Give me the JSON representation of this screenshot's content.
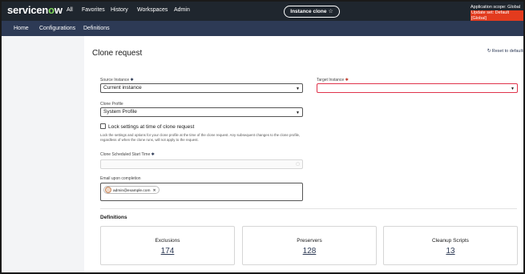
{
  "topbar": {
    "logo_main": "servicen",
    "logo_o": "o",
    "logo_end": "w",
    "nav": [
      "All",
      "Favorites",
      "History",
      "Workspaces",
      "Admin"
    ],
    "instance_pill": "Instance clone",
    "pill_icon": "star-icon",
    "scope_line": "Application scope: Global",
    "update_set_line": "Update set: Default [Global]"
  },
  "subnav": [
    "Home",
    "Configurations",
    "Definitions"
  ],
  "page": {
    "title": "Clone request",
    "reset_label": "Reset to defaults",
    "reset_icon": "refresh-icon"
  },
  "form": {
    "source_label": "Source Instance",
    "source_value": "Current instance",
    "target_label": "Target Instance",
    "target_value": "",
    "profile_label": "Clone Profile",
    "profile_value": "System Profile",
    "lock_label": "Lock settings at time of clone request",
    "lock_checked": false,
    "lock_help": "Lock the settings and options for your clone profile at the time of the clone request. Any subsequent changes to the clone profile, regardless of when the clone runs, will not apply to the request.",
    "start_time_label": "Clone Scheduled Start Time",
    "email_label": "Email upon completion",
    "email_chip": "admin@example.com",
    "required_mark": "✱"
  },
  "definitions": {
    "title": "Definitions",
    "cards": [
      {
        "title": "Exclusions",
        "count": "174"
      },
      {
        "title": "Preservers",
        "count": "128"
      },
      {
        "title": "Cleanup Scripts",
        "count": "13"
      }
    ]
  },
  "colors": {
    "topbar": "#1f262e",
    "subbar": "#2d3a55",
    "accent_green": "#7fd95a",
    "error_red": "#e0334b"
  }
}
